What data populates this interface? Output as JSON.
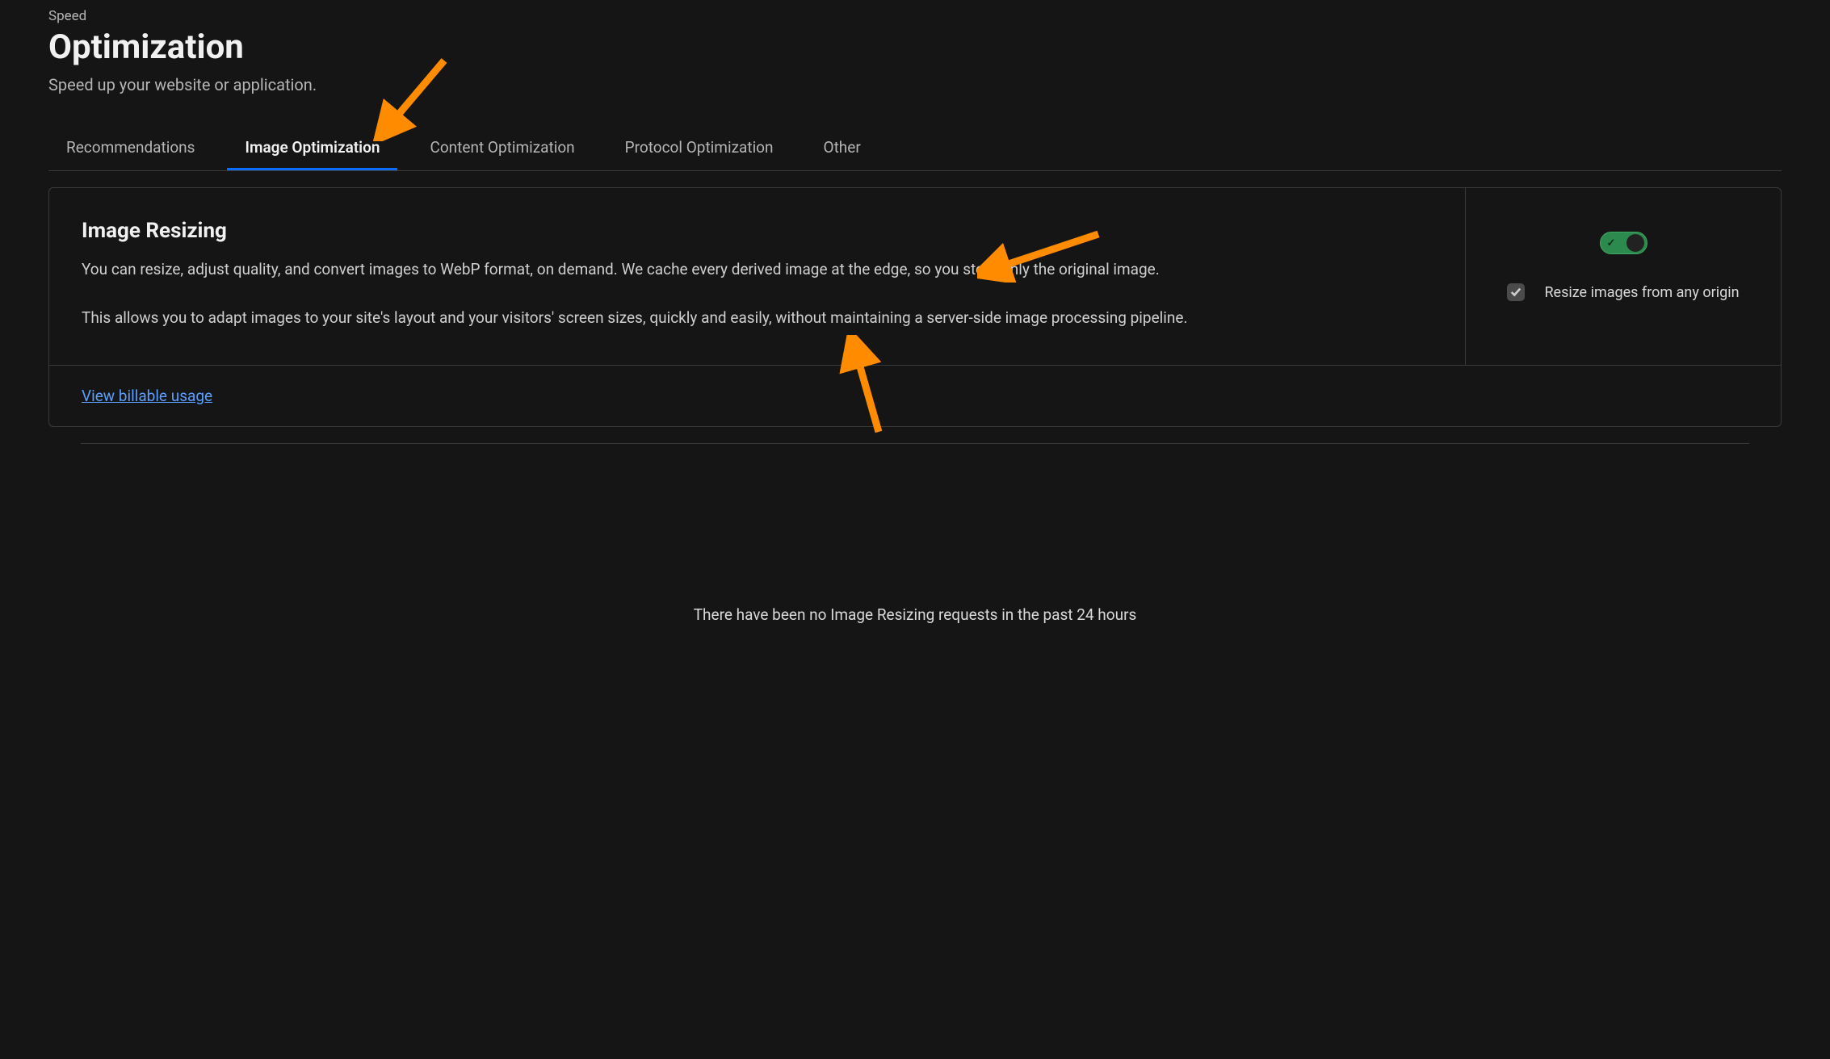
{
  "header": {
    "breadcrumb": "Speed",
    "title": "Optimization",
    "subtitle": "Speed up your website or application."
  },
  "tabs": [
    {
      "label": "Recommendations",
      "active": false
    },
    {
      "label": "Image Optimization",
      "active": true
    },
    {
      "label": "Content Optimization",
      "active": false
    },
    {
      "label": "Protocol Optimization",
      "active": false
    },
    {
      "label": "Other",
      "active": false
    }
  ],
  "feature": {
    "title": "Image Resizing",
    "desc1": "You can resize, adjust quality, and convert images to WebP format, on demand. We cache every derived image at the edge, so you store only the original image.",
    "desc2": "This allows you to adapt images to your site's layout and your visitors' screen sizes, quickly and easily, without maintaining a server-side image processing pipeline.",
    "toggle_on": true,
    "checkbox_label": "Resize images from any origin",
    "checkbox_checked": true,
    "footer_link": "View billable usage"
  },
  "empty_state": "There have been no Image Resizing requests in the past 24 hours"
}
